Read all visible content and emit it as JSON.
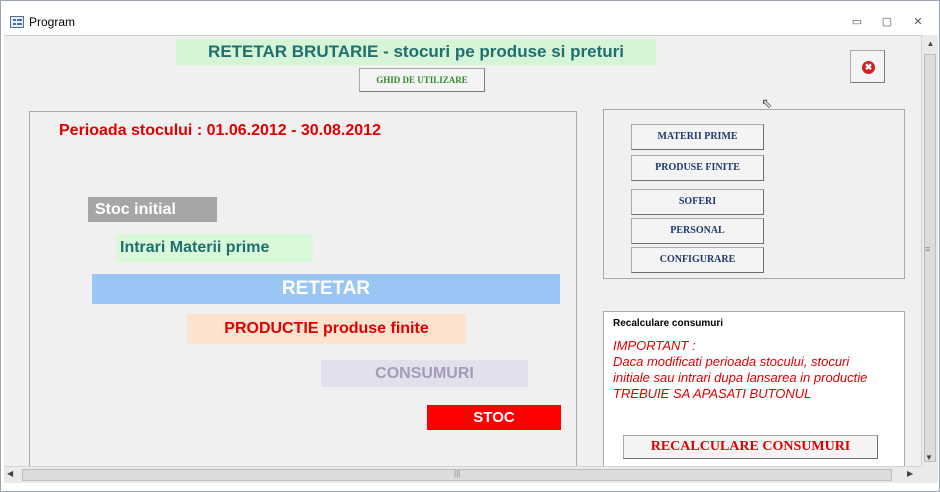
{
  "window": {
    "title": "Program",
    "controls": {
      "minimize": "▭",
      "maximize": "▢",
      "close": "✕"
    }
  },
  "header": {
    "title": "RETETAR BRUTARIE - stocuri pe produse si preturi",
    "guide_button": "GHID DE UTILIZARE",
    "close_icon": "✖"
  },
  "left": {
    "period": "Perioada stocului : 01.06.2012 - 30.08.2012",
    "flow": {
      "stoc_initial": "Stoc initial",
      "intrari": "Intrari Materii prime",
      "retetar": "RETETAR",
      "productie": "PRODUCTIE produse finite",
      "consumuri": "CONSUMURI",
      "stoc": "STOC"
    }
  },
  "nav": {
    "materii_prime": "MATERII PRIME",
    "produse_finite": "PRODUSE FINITE",
    "soferi": "SOFERI",
    "personal": "PERSONAL",
    "configurare": "CONFIGURARE"
  },
  "recalc": {
    "title": "Recalculare consumuri",
    "important": "IMPORTANT :\nDaca modificati perioada stocului, stocuri initiale sau intrari  dupa lansarea in productie TREBUIE SA APASATI BUTONUL",
    "button": "RECALCULARE CONSUMURI"
  },
  "scroll": {
    "grip_h": "|||",
    "grip_v": "≡"
  },
  "colors": {
    "title_bg": "#d6f5d6",
    "title_fg": "#1f6f6f",
    "alert_red": "#e00000",
    "retetar_bg": "#99c6f4",
    "stoc_bg": "#ff0000"
  }
}
